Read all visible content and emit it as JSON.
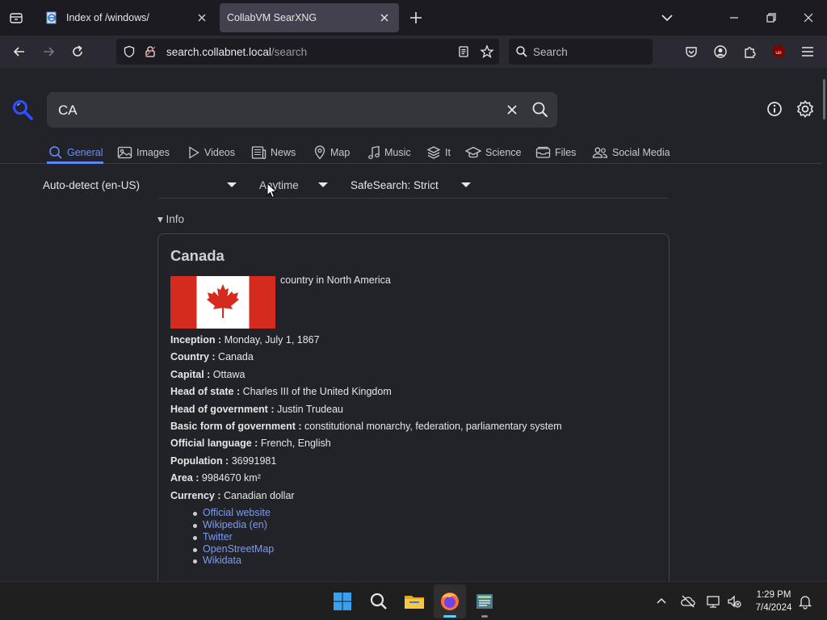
{
  "browser": {
    "tabs": [
      {
        "title": "Index of /windows/",
        "active": false
      },
      {
        "title": "CollabVM SearXNG",
        "active": true
      }
    ],
    "url": {
      "host": "search.collabnet.local",
      "path": "/search"
    },
    "search_placeholder": "Search"
  },
  "searxng": {
    "query": "CA",
    "categories": [
      {
        "label": "General",
        "icon": "search-icon",
        "active": true
      },
      {
        "label": "Images",
        "icon": "image-icon",
        "active": false
      },
      {
        "label": "Videos",
        "icon": "play-icon",
        "active": false
      },
      {
        "label": "News",
        "icon": "newspaper-icon",
        "active": false
      },
      {
        "label": "Map",
        "icon": "map-pin-icon",
        "active": false
      },
      {
        "label": "Music",
        "icon": "music-note-icon",
        "active": false
      },
      {
        "label": "It",
        "icon": "layers-icon",
        "active": false
      },
      {
        "label": "Science",
        "icon": "school-icon",
        "active": false
      },
      {
        "label": "Files",
        "icon": "file-tray-icon",
        "active": false
      },
      {
        "label": "Social Media",
        "icon": "people-icon",
        "active": false
      }
    ],
    "filters": {
      "language": "Auto-detect (en-US)",
      "time_range": "Anytime",
      "safesearch": "SafeSearch: Strict"
    },
    "info_toggle": "Info",
    "infobox": {
      "title": "Canada",
      "description": "country in North America",
      "attributes": [
        {
          "key": "Inception :",
          "value": "Monday, July 1, 1867"
        },
        {
          "key": "Country :",
          "value": "Canada"
        },
        {
          "key": "Capital :",
          "value": "Ottawa"
        },
        {
          "key": "Head of state :",
          "value": "Charles III of the United Kingdom"
        },
        {
          "key": "Head of government :",
          "value": "Justin Trudeau"
        },
        {
          "key": "Basic form of government :",
          "value": "constitutional monarchy, federation, parliamentary system"
        },
        {
          "key": "Official language :",
          "value": "French, English"
        },
        {
          "key": "Population :",
          "value": "36991981"
        },
        {
          "key": "Area :",
          "value": "9984670 km²"
        },
        {
          "key": "Currency :",
          "value": "Canadian dollar"
        }
      ],
      "links": [
        "Official website",
        "Wikipedia (en)",
        "Twitter",
        "OpenStreetMap",
        "Wikidata"
      ]
    },
    "accent_color": "#5d85f4",
    "link_color": "#7a9cf2"
  },
  "taskbar": {
    "time": "1:29 PM",
    "date": "7/4/2024",
    "pinned": [
      "windows-start-icon",
      "search-icon",
      "file-explorer-icon",
      "firefox-icon",
      "app-icon"
    ]
  }
}
